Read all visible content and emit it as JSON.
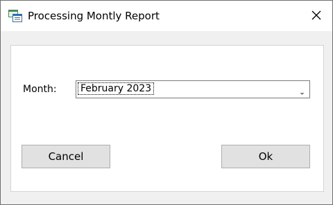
{
  "window": {
    "title": "Processing Montly Report",
    "icon": "report-window-icon",
    "close_icon": "close-icon"
  },
  "form": {
    "month_label": "Month:",
    "month_value": "February 2023"
  },
  "buttons": {
    "cancel_label": "Cancel",
    "ok_label": "Ok"
  }
}
